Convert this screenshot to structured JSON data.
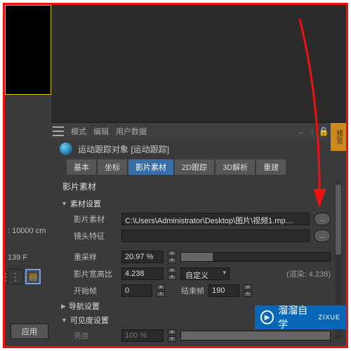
{
  "menu": {
    "mode": "模式",
    "edit": "编辑",
    "user_data": "用户数据"
  },
  "orange_tab": "预览",
  "object": {
    "title": "运动跟踪对象 [运动跟踪]"
  },
  "tabs": {
    "basic": "基本",
    "coord": "坐标",
    "footage": "影片素材",
    "track2d": "2D跟踪",
    "solve3d": "3D解析",
    "reconstruct": "重建"
  },
  "panel_title": "影片素材",
  "sections": {
    "material_settings": "素材设置",
    "nav_settings": "导航设置",
    "visibility_settings": "可见度设置"
  },
  "rows": {
    "footage_label": "影片素材",
    "footage_path": "C:\\Users\\Administrator\\Desktop\\图片\\视频1.mp…",
    "lens_label": "镜头特征",
    "resample_label": "重采样",
    "resample_value": "20.97 %",
    "aspect_label": "影片宽高比",
    "aspect_value": "4.238",
    "aspect_mode": "自定义",
    "render_label": "(渲染:  4.238)",
    "start_label": "开始帧",
    "start_value": "0",
    "end_label": "结束帧",
    "end_value": "190",
    "brightness_label": "亮度",
    "brightness_value": "100 %"
  },
  "left": {
    "distance": ": 10000 cm",
    "frames": "139 F"
  },
  "apply_button": "应用",
  "watermark": {
    "brand": "溜溜自学",
    "sub": "ZIXUE"
  },
  "dots": "..."
}
